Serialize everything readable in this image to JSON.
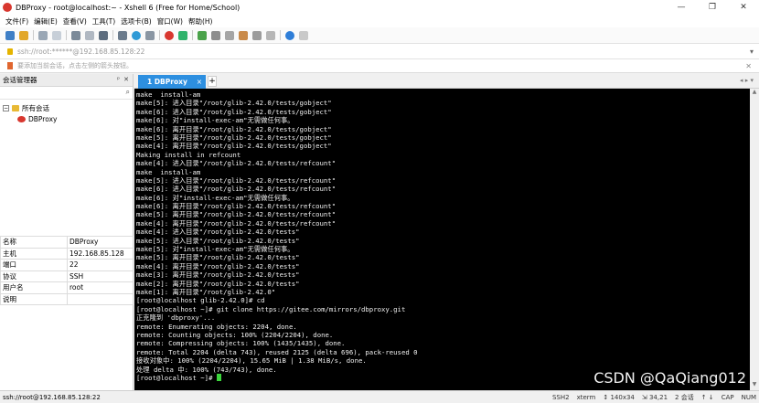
{
  "window": {
    "title": "DBProxy - root@localhost:~ - Xshell 6 (Free for Home/School)",
    "min": "—",
    "max": "❐",
    "close": "✕"
  },
  "menu": [
    "文件(F)",
    "编辑(E)",
    "查看(V)",
    "工具(T)",
    "选项卡(B)",
    "窗口(W)",
    "帮助(H)"
  ],
  "address": {
    "text": "ssh://root:******@192.168.85.128:22",
    "arrow": "▾"
  },
  "hint": {
    "text": "要添加当前会话，点击左侧的箭头按钮。",
    "close": "✕"
  },
  "sidebar": {
    "title": "会话管理器",
    "pin": "ᵖ",
    "close": "✕",
    "tree": {
      "root": "所有会话",
      "expander": "−",
      "child": "DBProxy"
    },
    "props": [
      {
        "k": "名称",
        "v": "DBProxy"
      },
      {
        "k": "主机",
        "v": "192.168.85.128"
      },
      {
        "k": "端口",
        "v": "22"
      },
      {
        "k": "协议",
        "v": "SSH"
      },
      {
        "k": "用户名",
        "v": "root"
      },
      {
        "k": "说明",
        "v": ""
      }
    ]
  },
  "tabs": {
    "active": "1 DBProxy",
    "close": "×",
    "add": "+",
    "nav": "◂ ▸ ▾"
  },
  "terminal": {
    "lines": [
      "make  install-am",
      "make[5]: 进入目录\"/root/glib-2.42.0/tests/gobject\"",
      "make[6]: 进入目录\"/root/glib-2.42.0/tests/gobject\"",
      "make[6]: 对\"install-exec-am\"无需做任何事。",
      "make[6]: 离开目录\"/root/glib-2.42.0/tests/gobject\"",
      "make[5]: 离开目录\"/root/glib-2.42.0/tests/gobject\"",
      "make[4]: 离开目录\"/root/glib-2.42.0/tests/gobject\"",
      "Making install in refcount",
      "make[4]: 进入目录\"/root/glib-2.42.0/tests/refcount\"",
      "make  install-am",
      "make[5]: 进入目录\"/root/glib-2.42.0/tests/refcount\"",
      "make[6]: 进入目录\"/root/glib-2.42.0/tests/refcount\"",
      "make[6]: 对\"install-exec-am\"无需做任何事。",
      "make[6]: 离开目录\"/root/glib-2.42.0/tests/refcount\"",
      "make[5]: 离开目录\"/root/glib-2.42.0/tests/refcount\"",
      "make[4]: 离开目录\"/root/glib-2.42.0/tests/refcount\"",
      "make[4]: 进入目录\"/root/glib-2.42.0/tests\"",
      "make[5]: 进入目录\"/root/glib-2.42.0/tests\"",
      "make[5]: 对\"install-exec-am\"无需做任何事。",
      "make[5]: 离开目录\"/root/glib-2.42.0/tests\"",
      "make[4]: 离开目录\"/root/glib-2.42.0/tests\"",
      "make[3]: 离开目录\"/root/glib-2.42.0/tests\"",
      "make[2]: 离开目录\"/root/glib-2.42.0/tests\"",
      "make[1]: 离开目录\"/root/glib-2.42.0\"",
      "[root@localhost glib-2.42.0]# cd",
      "[root@localhost ~]# git clone https://gitee.com/mirrors/dbproxy.git",
      "正克隆到 'dbproxy'...",
      "remote: Enumerating objects: 2204, done.",
      "remote: Counting objects: 100% (2204/2204), done.",
      "remote: Compressing objects: 100% (1435/1435), done.",
      "remote: Total 2204 (delta 743), reused 2125 (delta 696), pack-reused 0",
      "接收对象中: 100% (2204/2204), 15.65 MiB | 1.38 MiB/s, done.",
      "处理 delta 中: 100% (743/743), done."
    ],
    "prompt": "[root@localhost ~]# ",
    "watermark": "CSDN @QaQiang012"
  },
  "status": {
    "left": "ssh://root@192.168.85.128:22",
    "protocol": "SSH2",
    "term": "xterm",
    "size": "↕ 140x34",
    "pos": "⇲ 34,21",
    "sessions": "2 会话",
    "arrows": "↑ ↓",
    "caps": "CAP",
    "num": "NUM"
  }
}
